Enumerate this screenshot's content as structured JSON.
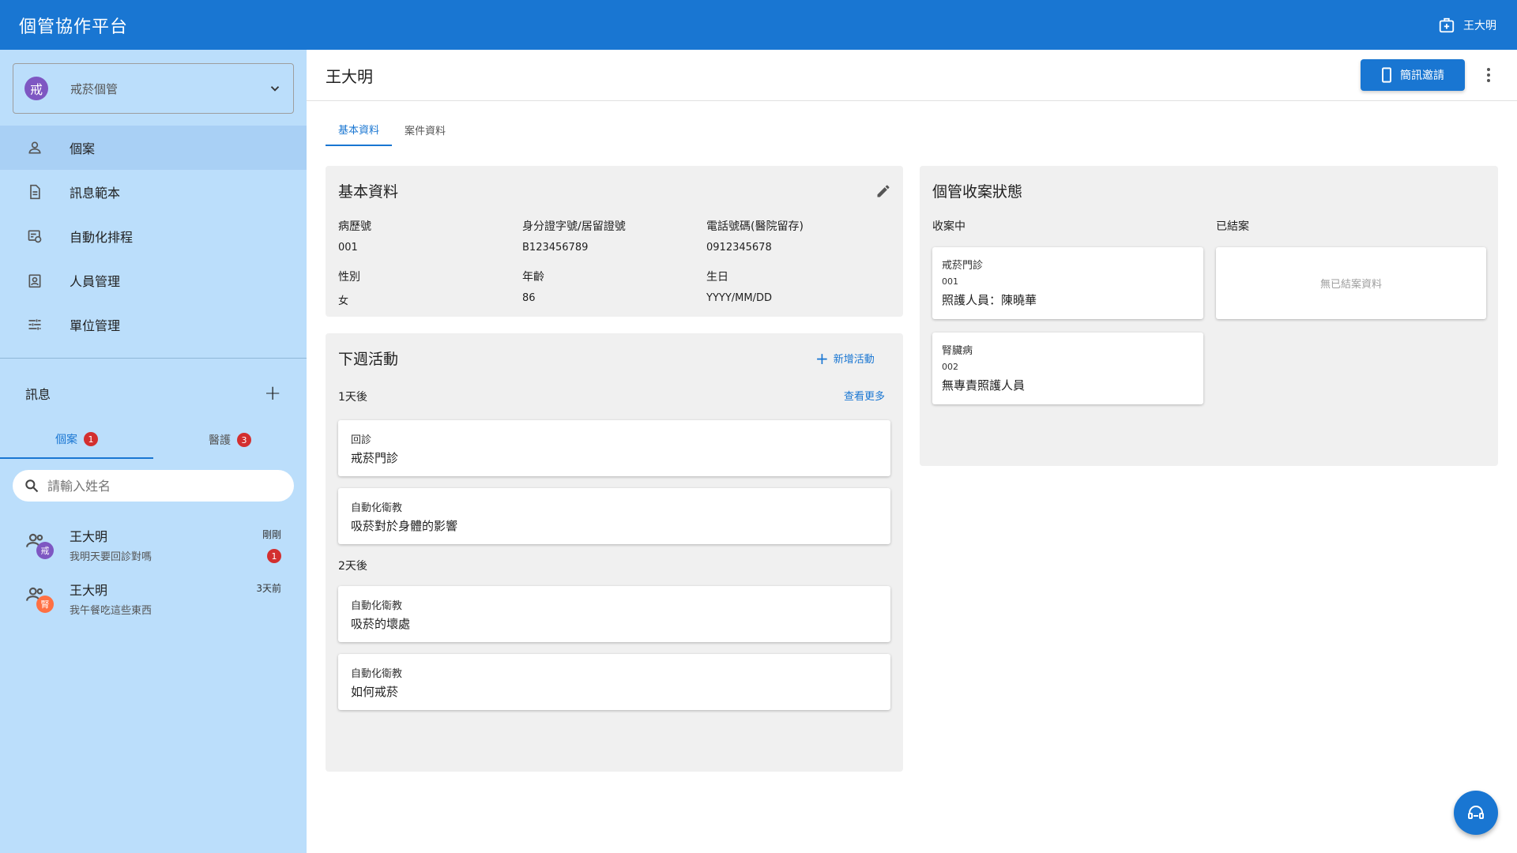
{
  "app": {
    "title": "個管協作平台",
    "user_name": "王大明"
  },
  "sidebar": {
    "unit": {
      "avatar_char": "戒",
      "name": "戒菸個管"
    },
    "nav": [
      {
        "label": "個案",
        "icon": "person-icon"
      },
      {
        "label": "訊息範本",
        "icon": "document-icon"
      },
      {
        "label": "自動化排程",
        "icon": "schedule-icon"
      },
      {
        "label": "人員管理",
        "icon": "badge-icon"
      },
      {
        "label": "單位管理",
        "icon": "tune-icon"
      }
    ],
    "messages": {
      "title": "訊息",
      "tabs": [
        {
          "label": "個案",
          "count": "1"
        },
        {
          "label": "醫護",
          "count": "3"
        }
      ],
      "search_placeholder": "請輸入姓名",
      "conversations": [
        {
          "name": "王大明",
          "preview": "我明天要回診對嗎",
          "time": "剛剛",
          "tag": "戒",
          "tag_color": "#7e57c2",
          "unread": "1"
        },
        {
          "name": "王大明",
          "preview": "我午餐吃這些東西",
          "time": "3天前",
          "tag": "腎",
          "tag_color": "#ff7043",
          "unread": ""
        }
      ]
    }
  },
  "main": {
    "patient_name": "王大明",
    "sms_button": "簡訊邀請",
    "tabs": [
      "基本資料",
      "案件資料"
    ],
    "basic": {
      "title": "基本資料",
      "fields": [
        {
          "label": "病歷號",
          "value": "001"
        },
        {
          "label": "身分證字號/居留證號",
          "value": "B123456789"
        },
        {
          "label": "電話號碼(醫院留存)",
          "value": "0912345678"
        },
        {
          "label": "性別",
          "value": "女"
        },
        {
          "label": "年齡",
          "value": "86"
        },
        {
          "label": "生日",
          "value": "YYYY/MM/DD"
        }
      ]
    },
    "activities": {
      "title": "下週活動",
      "add_label": "新增活動",
      "more_label": "查看更多",
      "groups": [
        {
          "label": "1天後",
          "items": [
            {
              "type": "回診",
              "title": "戒菸門診"
            },
            {
              "type": "自動化衛教",
              "title": "吸菸對於身體的影響"
            }
          ]
        },
        {
          "label": "2天後",
          "items": [
            {
              "type": "自動化衛教",
              "title": "吸菸的壞處"
            },
            {
              "type": "自動化衛教",
              "title": "如何戒菸"
            }
          ]
        }
      ]
    },
    "cases": {
      "title": "個管收案狀態",
      "open_label": "收案中",
      "closed_label": "已結案",
      "open": [
        {
          "name": "戒菸門診",
          "code": "001",
          "caretaker": "照護人員：陳曉華"
        },
        {
          "name": "腎臟病",
          "code": "002",
          "caretaker": "無專責照護人員"
        }
      ],
      "closed_empty": "無已結案資料"
    }
  },
  "colors": {
    "primary": "#1976d2",
    "sidebar_bg": "#bbdefb",
    "badge": "#d32f2f"
  }
}
